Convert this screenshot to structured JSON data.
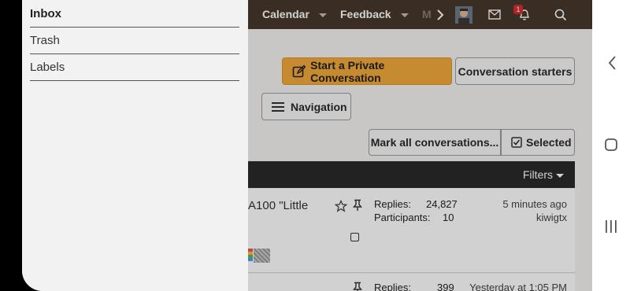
{
  "header": {
    "nav": [
      {
        "label": "Calendar"
      },
      {
        "label": "Feedback"
      },
      {
        "label": "M"
      }
    ],
    "notification_count": "1"
  },
  "actions": {
    "start_conversation": "Start a Private Conversation",
    "conversation_starters": "Conversation starters",
    "navigation": "Navigation",
    "mark_all": "Mark all conversations...",
    "selected": "Selected"
  },
  "list": {
    "filters_label": "Filters",
    "rows": [
      {
        "title": "A100 \"Little",
        "replies_label": "Replies:",
        "replies": "24,827",
        "participants_label": "Participants:",
        "participants": "10",
        "time": "5 minutes ago",
        "user": "kiwigtx"
      },
      {
        "replies_label": "Replies:",
        "replies": "399",
        "time": "Yesterday at 1:05 PM"
      }
    ]
  },
  "drawer": {
    "items": [
      {
        "label": "Inbox"
      },
      {
        "label": "Trash"
      },
      {
        "label": "Labels"
      }
    ]
  },
  "colors": {
    "header_bg": "#47392c",
    "primary_button": "#f2a93b",
    "list_header": "#2a2a2a",
    "badge": "#d32f2f"
  }
}
